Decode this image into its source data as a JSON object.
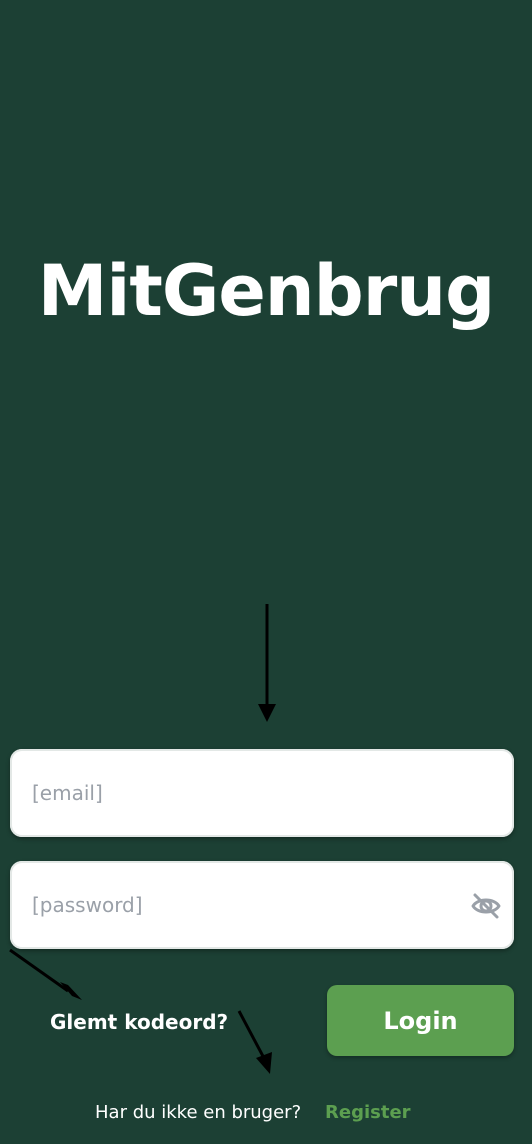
{
  "app": {
    "title": "MitGenbrug"
  },
  "login_form": {
    "email_placeholder": "[email]",
    "email_value": "",
    "password_placeholder": "[password]",
    "password_value": "",
    "password_toggle_icon": "eye-off-icon",
    "forgot_password_label": "Glemt kodeord?",
    "login_label": "Login"
  },
  "register": {
    "prompt": "Har du ikke en bruger?",
    "link_label": "Register"
  },
  "colors": {
    "background": "#1c4034",
    "accent": "#5c9f50",
    "field_background": "#ffffff",
    "placeholder": "#9aa0a8"
  }
}
